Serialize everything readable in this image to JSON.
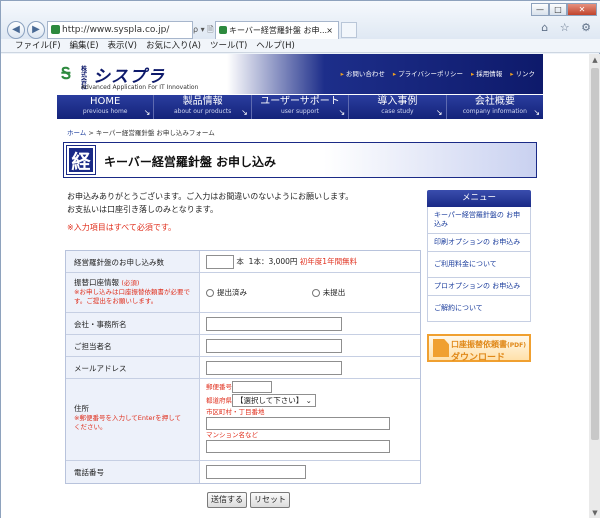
{
  "browser": {
    "url": "http://www.syspla.co.jp/",
    "address_controls": "ρ ▾ 🗎 Ċ",
    "tab_title": "キーバー経営羅針盤 お申...",
    "tab_close": "×",
    "menu": [
      "ファイル(F)",
      "編集(E)",
      "表示(V)",
      "お気に入り(A)",
      "ツール(T)",
      "ヘルプ(H)"
    ],
    "win_buttons": [
      "—",
      "□",
      "✕"
    ],
    "tools_icons": "⌂ ☆ ⚙"
  },
  "site": {
    "logo_kabushiki": "株式会社",
    "logo_name": "シスプラ",
    "logo_tagline": "Advanced Application For IT Innovation",
    "top_links": [
      "お問い合わせ",
      "プライバシーポリシー",
      "採用情報",
      "リンク"
    ],
    "nav": [
      {
        "ja": "HOME",
        "en": "previous home"
      },
      {
        "ja": "製品情報",
        "en": "about our products"
      },
      {
        "ja": "ユーザーサポート",
        "en": "user support"
      },
      {
        "ja": "導入事例",
        "en": "case study"
      },
      {
        "ja": "会社概要",
        "en": "company information"
      }
    ]
  },
  "breadcrumb": {
    "home": "ホーム",
    "sep": " > ",
    "current": "キーパー経営羅針盤 お申し込みフォーム"
  },
  "page": {
    "title_kanji": "経",
    "title": "キーバー経営羅針盤 お申し込み",
    "intro1": "お申込みありがとうございます。ご入力はお間違いのないようにお願いします。",
    "intro2": "お支払いは口座引き落しのみとなります。",
    "required_note": "※入力項目はすべて必須です。"
  },
  "form": {
    "qty_label": "経営羅針盤のお申し込み数",
    "qty_value": "",
    "qty_unit": "本",
    "qty_price": "1本：3,000円",
    "qty_free": "初年度1年間無料",
    "bank_label": "振替口座情報",
    "bank_required": "(必須)",
    "bank_note": "※お申し込みは口座振替依頼書が必要です。ご提出をお願いします。",
    "bank_opt1": "提出済み",
    "bank_opt2": "未提出",
    "company_label": "会社・事務所名",
    "company_value": "",
    "person_label": "ご担当者名",
    "person_value": "",
    "email_label": "メールアドレス",
    "email_value": "",
    "address_label": "住所",
    "address_note": "※郵便番号を入力してEnterを押してください。",
    "zip_label": "郵便番号",
    "zip_value": "",
    "pref_label": "都道府県",
    "pref_value": "【選択して下さい】",
    "city_label": "市区町村・丁目番地",
    "city_value": "",
    "building_label": "マンション名など",
    "building_value": "",
    "tel_label": "電話番号",
    "tel_value": "",
    "submit": "送信する",
    "reset": "リセット"
  },
  "sidebar": {
    "heading": "メニュー",
    "items": [
      "キーパー経営羅針盤の お申込み",
      "印刷オプションの お申込み",
      "ご利用料金について",
      "プロオプションの お申込み",
      "ご解約について"
    ],
    "download_line1": "口座振替依頼書",
    "download_pdf": "(PDF)",
    "download_line2": "ダウンロード"
  }
}
